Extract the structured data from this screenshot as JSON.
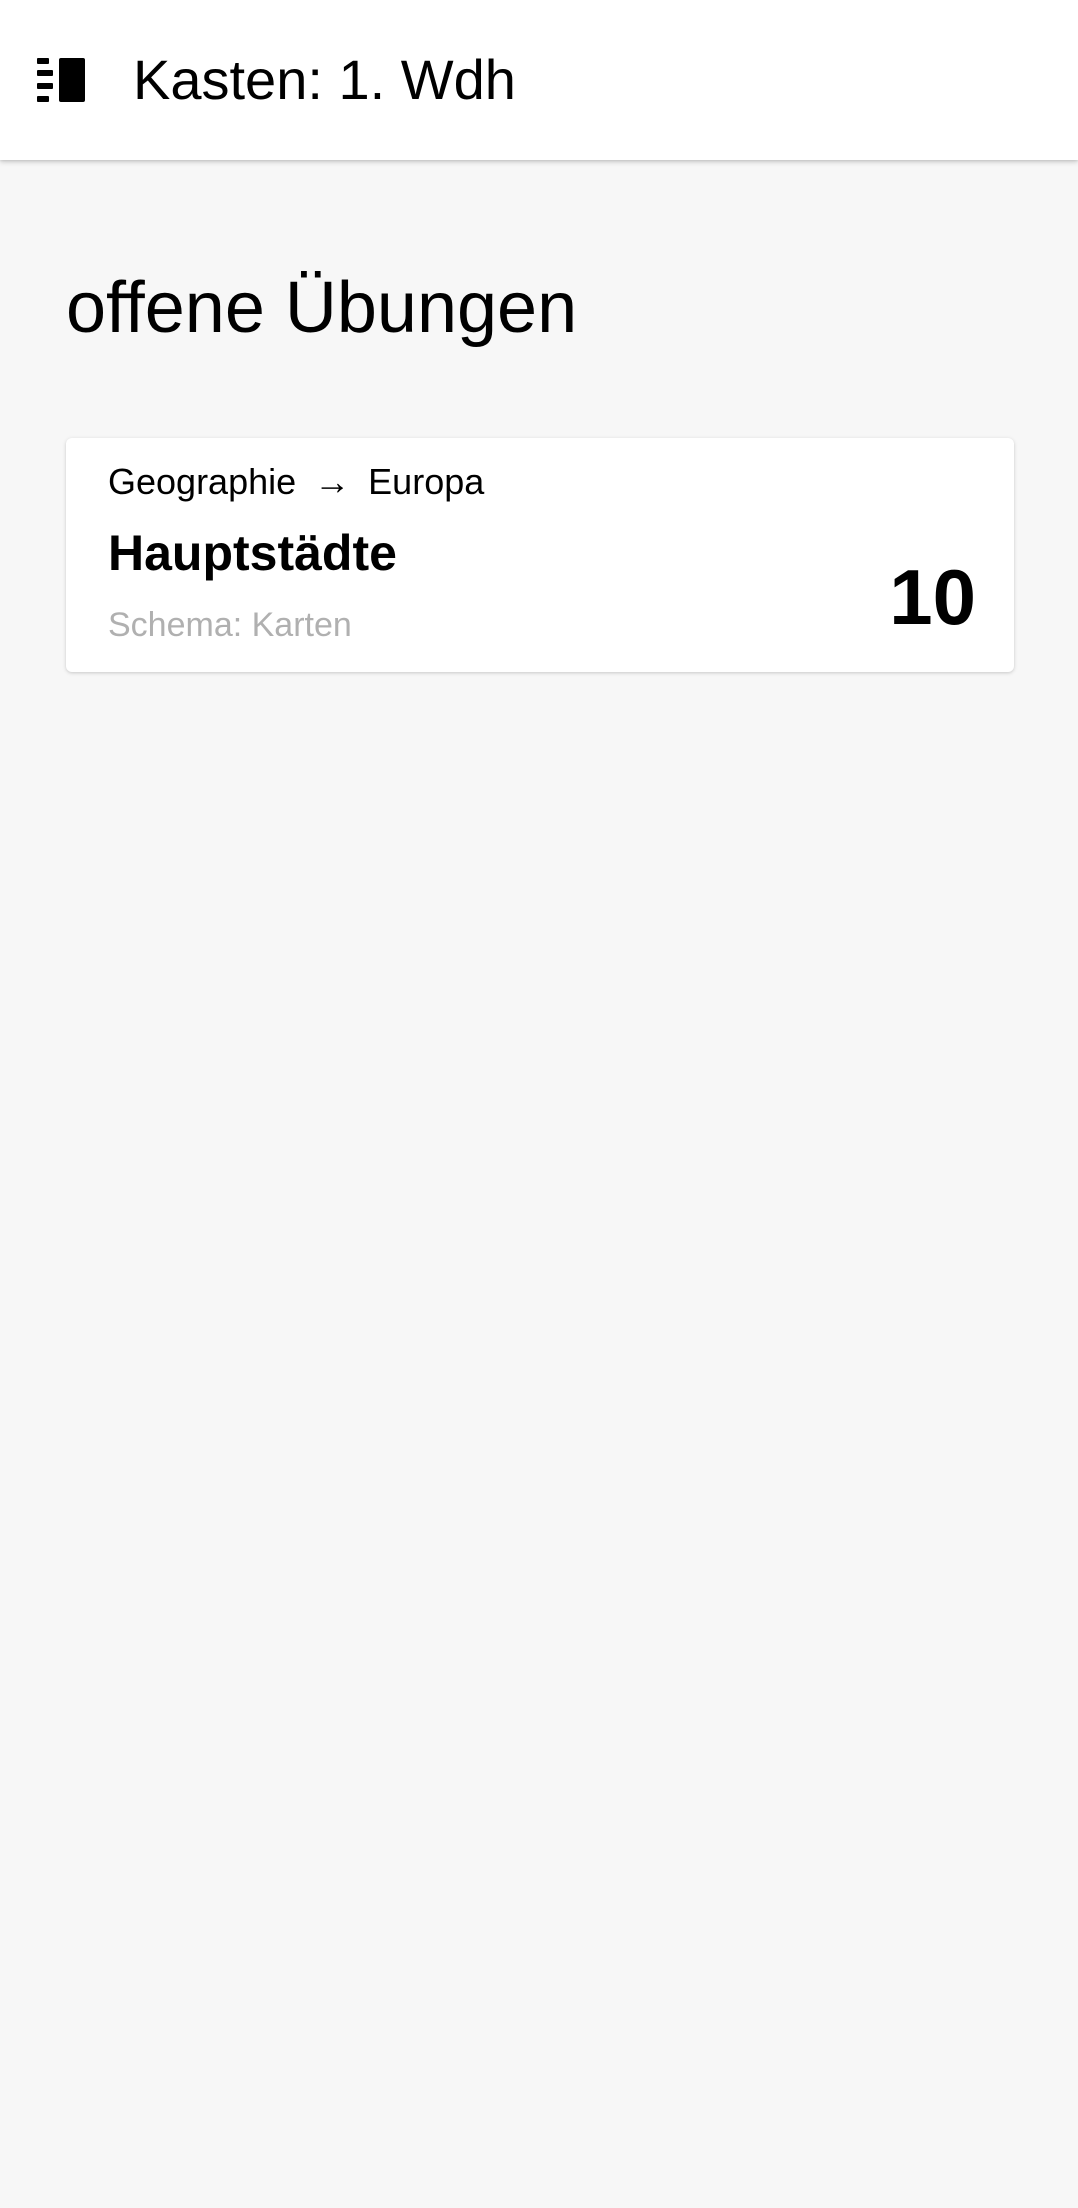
{
  "app_bar": {
    "title": "Kasten: 1. Wdh",
    "menu_icon": "menu-list-icon"
  },
  "main": {
    "section_title": "offene Übungen",
    "exercises": [
      {
        "path_from": "Geographie",
        "path_arrow": "→",
        "path_to": "Europa",
        "title": "Hauptstädte",
        "schema": "Schema: Karten",
        "count": "10"
      }
    ]
  },
  "colors": {
    "background": "#f7f7f7",
    "surface": "#ffffff",
    "text": "#000000",
    "secondary_text": "#b0b0b0"
  }
}
